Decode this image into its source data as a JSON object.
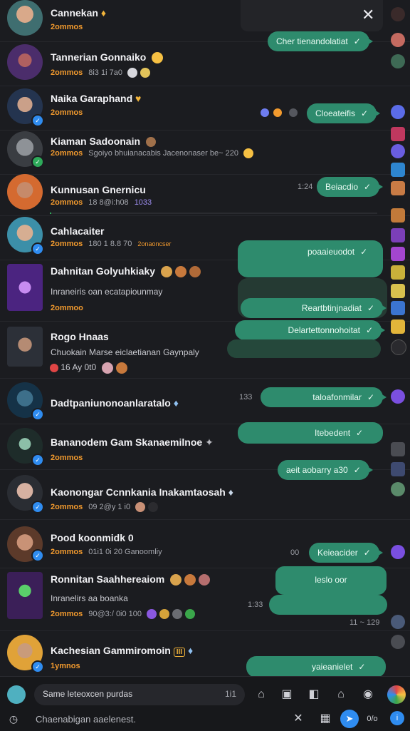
{
  "window": {
    "close_glyph": "✕"
  },
  "rows": [
    {
      "name": "Cannekan",
      "sub": "2ommos",
      "meta": "",
      "badge": "♦"
    },
    {
      "name": "Tannerian Gonnaiko",
      "sub": "2ommos",
      "meta": "8i3 1i 7a0",
      "badge": ""
    },
    {
      "name": "Naika Garaphand",
      "sub": "2ommos",
      "meta": "",
      "badge": "♥"
    },
    {
      "name": "Kiaman Sadoonain",
      "sub": "2ommos",
      "meta": "Sgoiyo bhuianacabis Jacenonaser be~ 220",
      "badge": ""
    },
    {
      "name": "Kunnusan Gnernicu",
      "sub": "2ommos",
      "meta": "18 8@i:h08",
      "extra": "1033",
      "badge": ""
    },
    {
      "name": "Cahlacaiter",
      "sub": "2ommos",
      "meta": "180 1 8.8 70",
      "extra": "2onaoncser",
      "badge": ""
    },
    {
      "name": "Dahnitan Golyuhkiaky",
      "sub": "2ommoo",
      "preview": "Inraneiris oan ecatapiounmay",
      "badge": ""
    },
    {
      "name": "Rogo Hnaas",
      "preview": "Chuokain Marse eiclaetianan Gaynpaly",
      "meta": "16 Ay 0t0",
      "badge": ""
    },
    {
      "name": "Dadtpaniunonoanlaratalo",
      "sub": "",
      "badge": "♦"
    },
    {
      "name": "Bananodem Gam Skanaemilnoe",
      "sub": "2ommos",
      "badge": "✦"
    },
    {
      "name": "Kaonongar Ccnnkania Inakamtaosah",
      "sub": "2ommos",
      "meta": "09 2@y 1 i0",
      "badge": "♦"
    },
    {
      "name": "Pood koonmidk 0",
      "sub": "2ommos",
      "meta": "01i1 0i 20 Ganoomliy",
      "badge": ""
    },
    {
      "name": "Ronnitan Saahhereaiom",
      "sub": "2ommos",
      "preview": "Inranelirs aa boanka",
      "meta": "90@3:/ 0i0 100",
      "badge": ""
    },
    {
      "name": "Kachesian Gammiromoin",
      "sub": "1ymnos",
      "badge": "♦"
    }
  ],
  "bubbles": [
    "Cher tienandolatiat",
    "Cloeateifis",
    "Beiacdio",
    "poaaieuodot",
    "Reartbtinjnadiat",
    "Delartettonnohoitat",
    "taloafonmilar",
    "Itebedent",
    "aeit aobarry a30",
    "Keieacider",
    "leslo oor",
    "yaieanielet"
  ],
  "times": [
    "1:24",
    "133",
    "1:33",
    "00",
    "1:33",
    "11 ~ 129"
  ],
  "composer": {
    "input_text": "Same leteoxcen purdas",
    "input_count": "1i1",
    "status_text": "Chaenabigan aaelenest."
  },
  "colors": {
    "bubble": "#2e8b6d",
    "accent_orange": "#f29a2e",
    "verify_blue": "#2f8cf0"
  }
}
